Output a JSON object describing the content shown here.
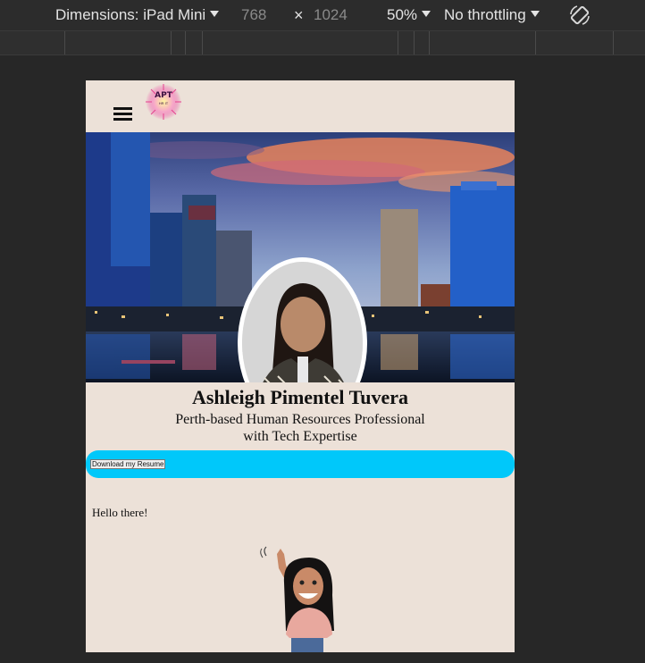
{
  "devtools": {
    "dimensions_label": "Dimensions: iPad Mini",
    "width": "768",
    "times": "×",
    "height": "1024",
    "zoom": "50%",
    "throttling": "No throttling",
    "rotate_icon": "rotate-icon"
  },
  "site": {
    "menu_icon": "hamburger-menu-icon",
    "logo_text": "APT",
    "logo_subtext": "HR IT",
    "name": "Ashleigh Pimentel Tuvera",
    "subtitle_line1": "Perth-based Human Resources Professional",
    "subtitle_line2": "with Tech Expertise",
    "resume_button": "Download my Resume",
    "greeting": "Hello there!"
  },
  "colors": {
    "page_bg": "#ece1d8",
    "resume_bar": "#00c8fa",
    "devtools_bg": "#2c2c2c"
  }
}
